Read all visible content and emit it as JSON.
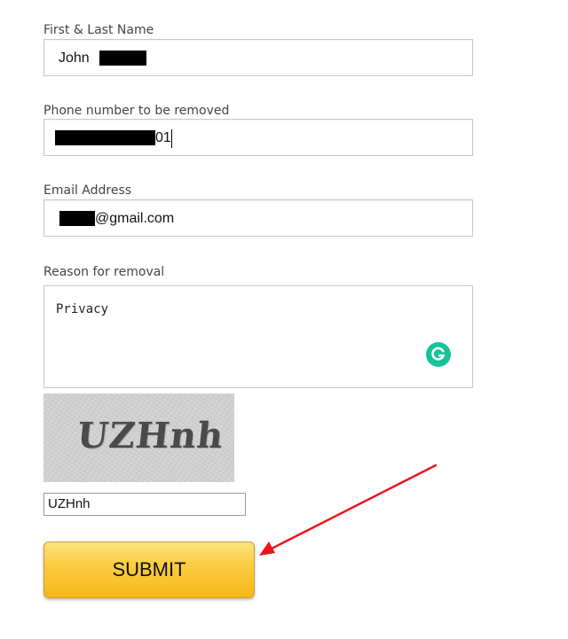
{
  "form": {
    "name": {
      "label": "First & Last Name",
      "value": "John"
    },
    "phone": {
      "label": "Phone number to be removed",
      "value_suffix": "01"
    },
    "email": {
      "label": "Email Address",
      "value_suffix": "@gmail.com"
    },
    "reason": {
      "label": "Reason for removal",
      "value": "Privacy"
    },
    "captcha": {
      "image_text": "UZHnh",
      "input_value": "UZHnh"
    },
    "submit_label": "SUBMIT"
  },
  "colors": {
    "button_gradient_top": "#fde27c",
    "button_gradient_bottom": "#f6b71c",
    "annotation_arrow": "#e8161b",
    "grammarly_icon": "#15c39a",
    "redaction": "#000000"
  },
  "icons": {
    "grammarly": "grammarly-icon",
    "annotation": "red-arrow"
  }
}
